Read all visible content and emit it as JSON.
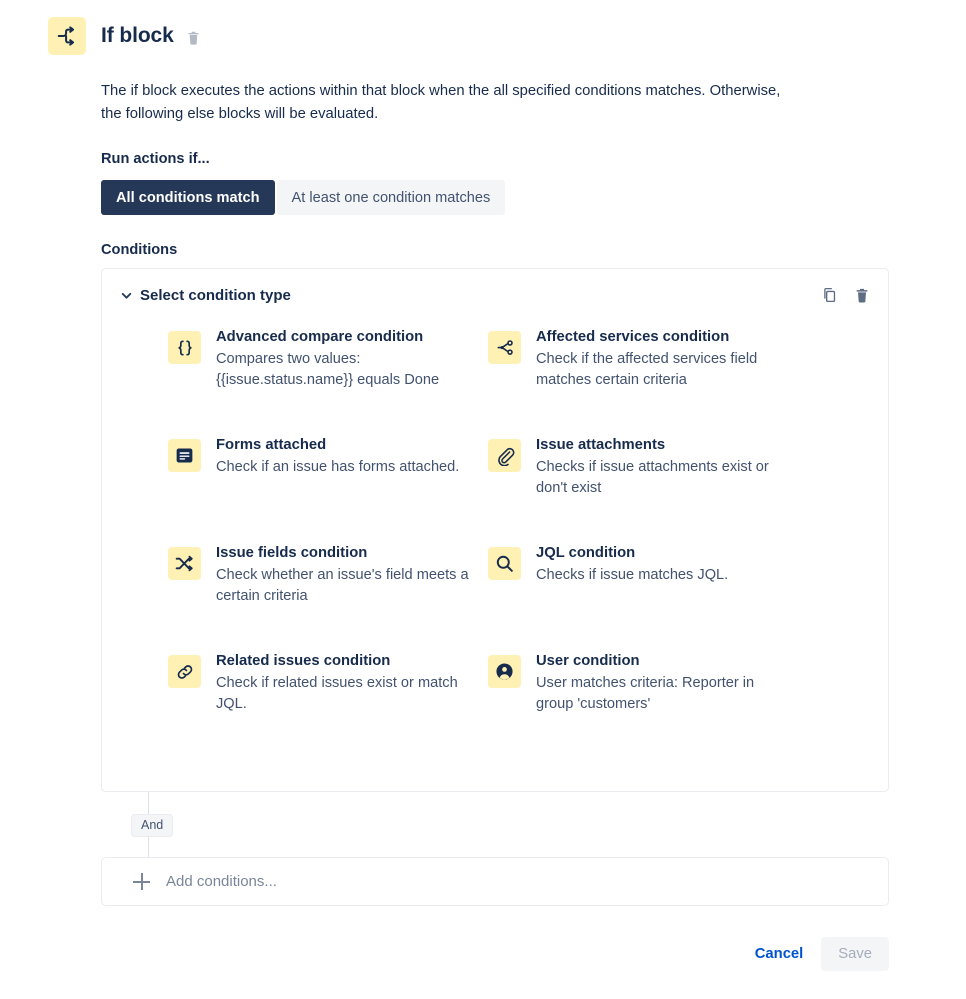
{
  "header": {
    "icon": "if-block-branch-icon",
    "title": "If block",
    "delete_icon": "trash-icon"
  },
  "description": "The if block executes the actions within that block when the all specified conditions matches. Otherwise, the following else blocks will be evaluated.",
  "run_actions": {
    "label": "Run actions if...",
    "options": [
      {
        "label": "All conditions match",
        "selected": true
      },
      {
        "label": "At least one condition matches",
        "selected": false
      }
    ]
  },
  "conditions_section": {
    "label": "Conditions",
    "panel": {
      "chevron_icon": "chevron-down-icon",
      "title": "Select condition type",
      "copy_icon": "copy-icon",
      "delete_icon": "trash-icon",
      "items": [
        {
          "icon": "curly-braces-icon",
          "name": "Advanced compare condition",
          "desc": "Compares two values: {{issue.status.name}} equals Done"
        },
        {
          "icon": "affected-services-nodes-icon",
          "name": "Affected services condition",
          "desc": "Check if the affected services field matches certain criteria"
        },
        {
          "icon": "form-document-icon",
          "name": "Forms attached",
          "desc": "Check if an issue has forms attached."
        },
        {
          "icon": "paperclip-icon",
          "name": "Issue attachments",
          "desc": "Checks if issue attachments exist or don't exist"
        },
        {
          "icon": "shuffle-arrows-icon",
          "name": "Issue fields condition",
          "desc": "Check whether an issue's field meets a certain criteria"
        },
        {
          "icon": "magnifier-icon",
          "name": "JQL condition",
          "desc": "Checks if issue matches JQL."
        },
        {
          "icon": "link-chain-icon",
          "name": "Related issues condition",
          "desc": "Check if related issues exist or match JQL."
        },
        {
          "icon": "user-avatar-icon",
          "name": "User condition",
          "desc": "User matches criteria: Reporter in group 'customers'"
        }
      ]
    }
  },
  "connector_badge": "And",
  "add_conditions": {
    "icon": "plus-icon",
    "label": "Add conditions..."
  },
  "footer": {
    "cancel_label": "Cancel",
    "save_label": "Save"
  },
  "colors": {
    "icon_tile": "#fff0b3",
    "accent_navy": "#253858",
    "link_blue": "#0052cc",
    "text_primary": "#172b4d",
    "text_secondary": "#42526e",
    "muted": "#7a869a",
    "border": "#ebecf0"
  }
}
